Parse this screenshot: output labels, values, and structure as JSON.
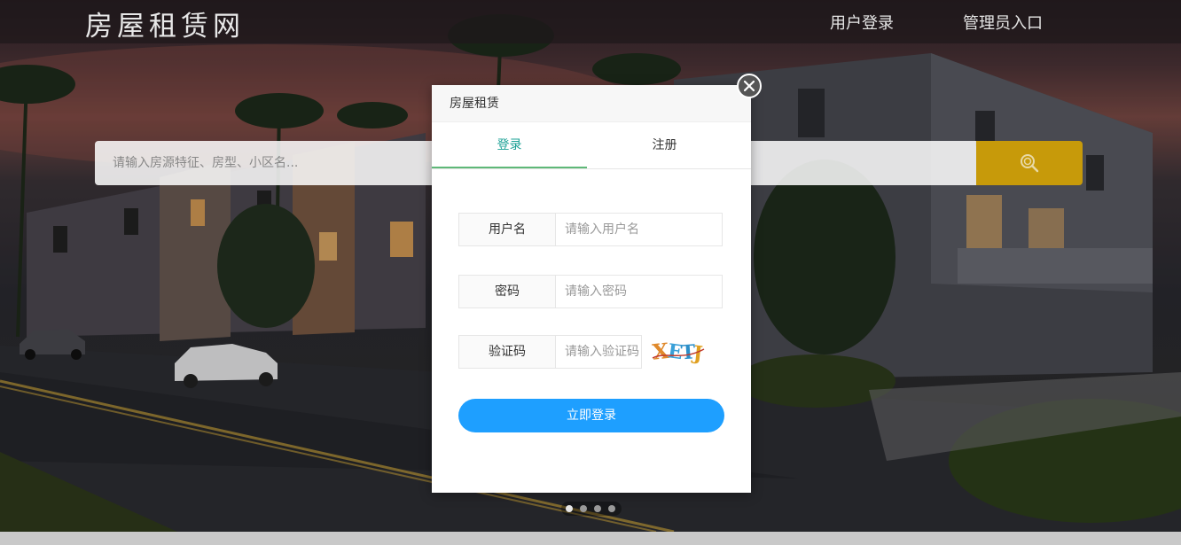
{
  "header": {
    "logo": "房屋租赁网",
    "nav": {
      "user_login": "用户登录",
      "admin_entry": "管理员入口"
    }
  },
  "search": {
    "placeholder": "请输入房源特征、房型、小区名..."
  },
  "modal": {
    "title": "房屋租赁",
    "tabs": {
      "login": "登录",
      "register": "注册"
    },
    "fields": {
      "username": {
        "label": "用户名",
        "placeholder": "请输入用户名",
        "value": ""
      },
      "password": {
        "label": "密码",
        "placeholder": "请输入密码",
        "value": ""
      },
      "captcha": {
        "label": "验证码",
        "placeholder": "请输入验证码",
        "value": "",
        "image_text": "XETJ"
      }
    },
    "submit": "立即登录"
  },
  "carousel": {
    "dot_count": 4,
    "active_index": 0
  },
  "colors": {
    "accent_tab": "#1aa094",
    "primary_button": "#1e9fff",
    "search_button": "#c79a0a"
  },
  "icons": {
    "search": "search-icon",
    "close": "close-icon"
  }
}
